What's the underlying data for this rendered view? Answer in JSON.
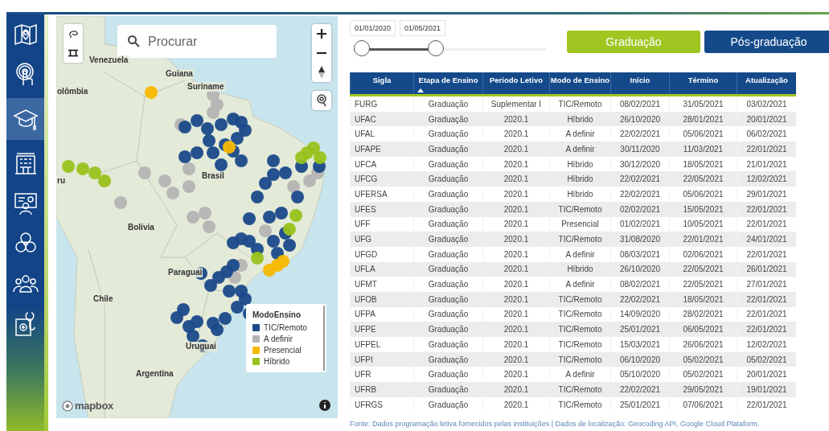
{
  "sidebar": {
    "items": [
      {
        "selected": false
      },
      {
        "selected": false
      },
      {
        "selected": true
      },
      {
        "selected": false
      },
      {
        "selected": false
      },
      {
        "selected": false
      },
      {
        "selected": false
      },
      {
        "selected": false
      }
    ]
  },
  "map": {
    "search": {
      "placeholder": "Procurar"
    },
    "labels": [
      "Venezuela",
      "Guiana",
      "Suriname",
      "olômbia",
      "Brasil",
      "ru",
      "Bolívia",
      "Paraguai",
      "Chile",
      "Uruguai",
      "Argentina"
    ],
    "legend": {
      "title": "ModoEnsino",
      "items": [
        {
          "label": "TIC/Remoto",
          "color": "#1a4a8a"
        },
        {
          "label": "A definir",
          "color": "#b4b4b4"
        },
        {
          "label": "Presencial",
          "color": "#f7b800"
        },
        {
          "label": "Híbrido",
          "color": "#99c21c"
        }
      ]
    },
    "attribution": "mapbox"
  },
  "date_range": {
    "start": "01/01/2020",
    "end": "01/05/2021",
    "thumbs": [
      {
        "level": 0
      },
      {
        "level": 0.42
      }
    ]
  },
  "buttons": [
    "Graduação",
    "Pós-graduação"
  ],
  "table": {
    "columns": [
      {
        "label": "Sigla",
        "sorted": false
      },
      {
        "label": "Etapa de Ensino",
        "sorted": true
      },
      {
        "label": "Periodo Letivo",
        "sorted": false
      },
      {
        "label": "Modo de Ensino",
        "sorted": false
      },
      {
        "label": "Início",
        "sorted": false
      },
      {
        "label": "Término",
        "sorted": false
      },
      {
        "label": "Atualização",
        "sorted": false
      }
    ],
    "rows": [
      [
        "FURG",
        "Graduação",
        "Suplementar I",
        "TIC/Remoto",
        "08/02/2021",
        "31/05/2021",
        "03/02/2021"
      ],
      [
        "UFAC",
        "Graduação",
        "2020.1",
        "Híbrido",
        "26/10/2020",
        "28/01/2021",
        "20/01/2021"
      ],
      [
        "UFAL",
        "Graduação",
        "2020.1",
        "A definir",
        "22/02/2021",
        "05/06/2021",
        "06/02/2021"
      ],
      [
        "UFAPE",
        "Graduação",
        "2020.1",
        "A definir",
        "30/11/2020",
        "11/03/2021",
        "22/01/2021"
      ],
      [
        "UFCA",
        "Graduação",
        "2020.1",
        "Híbrido",
        "30/12/2020",
        "18/05/2021",
        "21/01/2021"
      ],
      [
        "UFCG",
        "Graduação",
        "2020.1",
        "Híbrido",
        "22/02/2021",
        "22/05/2021",
        "12/02/2021"
      ],
      [
        "UFERSA",
        "Graduação",
        "2020.1",
        "Híbrido",
        "22/02/2021",
        "05/06/2021",
        "29/01/2021"
      ],
      [
        "UFES",
        "Graduação",
        "2020.1",
        "TIC/Remoto",
        "02/02/2021",
        "15/05/2021",
        "22/01/2021"
      ],
      [
        "UFF",
        "Graduação",
        "2020.1",
        "Presencial",
        "01/02/2021",
        "10/05/2021",
        "22/01/2021"
      ],
      [
        "UFG",
        "Graduação",
        "2020.1",
        "TIC/Remoto",
        "31/08/2020",
        "22/01/2021",
        "24/01/2021"
      ],
      [
        "UFGD",
        "Graduação",
        "2020.1",
        "A definir",
        "08/03/2021",
        "02/06/2021",
        "22/01/2021"
      ],
      [
        "UFLA",
        "Graduação",
        "2020.1",
        "Híbrido",
        "26/10/2020",
        "22/05/2021",
        "26/01/2021"
      ],
      [
        "UFMT",
        "Graduação",
        "2020.1",
        "A definir",
        "08/02/2021",
        "22/05/2021",
        "27/01/2021"
      ],
      [
        "UFOB",
        "Graduação",
        "2020.1",
        "TIC/Remoto",
        "22/02/2021",
        "18/05/2021",
        "22/01/2021"
      ],
      [
        "UFPA",
        "Graduação",
        "2020.1",
        "TIC/Remoto",
        "14/09/2020",
        "28/02/2021",
        "22/01/2021"
      ],
      [
        "UFPE",
        "Graduação",
        "2020.1",
        "TIC/Remoto",
        "25/01/2021",
        "06/05/2021",
        "22/01/2021"
      ],
      [
        "UFPEL",
        "Graduação",
        "2020.1",
        "TIC/Remoto",
        "15/03/2021",
        "26/06/2021",
        "12/02/2021"
      ],
      [
        "UFPI",
        "Graduação",
        "2020.1",
        "TIC/Remoto",
        "06/10/2020",
        "05/02/2021",
        "05/02/2021"
      ],
      [
        "UFR",
        "Graduação",
        "2020.1",
        "A definir",
        "05/10/2020",
        "05/02/2021",
        "20/01/2021"
      ],
      [
        "UFRB",
        "Graduação",
        "2020.1",
        "TIC/Remoto",
        "22/02/2021",
        "29/05/2021",
        "19/01/2021"
      ],
      [
        "UFRGS",
        "Graduação",
        "2020.1",
        "TIC/Remoto",
        "25/01/2021",
        "07/06/2021",
        "22/01/2021"
      ]
    ]
  },
  "footer": "Fonte: Dados programação letiva fornecidos pelas instituições | Dados de localização: Geocoding API, Google Cloud Plataform."
}
